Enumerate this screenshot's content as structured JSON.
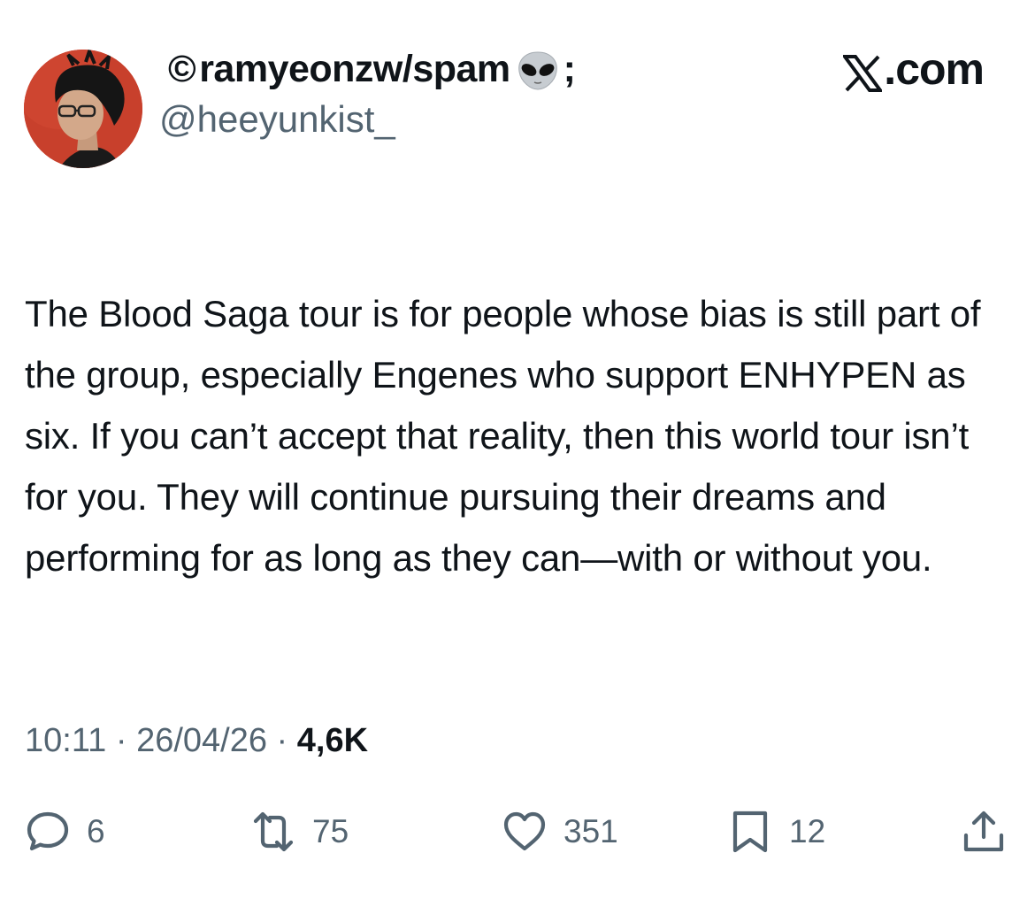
{
  "author": {
    "copyright_symbol": "©",
    "display_name": "ramyeonzw/spam",
    "name_suffix": ";",
    "handle": "@heeyunkist_",
    "name_emoji_icon": "alien-icon"
  },
  "brand": {
    "label": ".com",
    "logo_icon": "x-logo-icon"
  },
  "tweet": {
    "text": "The Blood Saga tour is for people whose bias is still part of the group, especially Engenes who support ENHYPEN as six. If you can’t accept that reality, then this world tour isn’t for you. They will continue pursuing their dreams and performing for as long as they can—with or without you.",
    "time": "10:11",
    "date": "26/04/26",
    "separator": " · ",
    "views": "4,6K"
  },
  "actions": {
    "replies": "6",
    "reposts": "75",
    "likes": "351",
    "bookmarks": "12"
  },
  "colors": {
    "text": "#0f1419",
    "secondary": "#536471",
    "avatar_bg": "#c23a2a"
  }
}
